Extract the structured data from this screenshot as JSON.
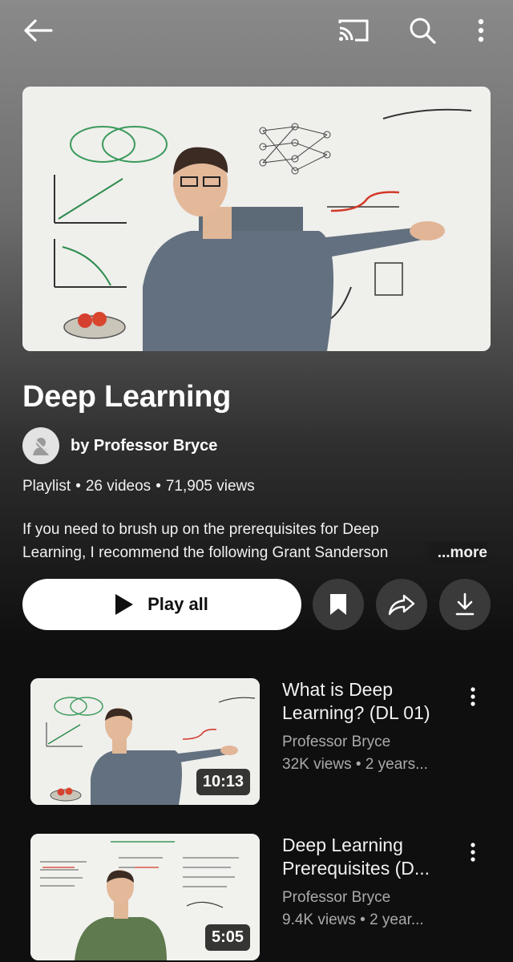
{
  "topbar": {
    "back_icon": "arrow-left-icon",
    "cast_icon": "cast-icon",
    "search_icon": "search-icon",
    "more_icon": "more-vertical-icon"
  },
  "playlist": {
    "title": "Deep Learning",
    "owner": "by Professor Bryce",
    "type": "Playlist",
    "video_count": "26 videos",
    "views": "71,905 views",
    "description_line1": "If you need to brush up on the prerequisites for Deep",
    "description_line2": "Learning, I recommend the following Grant Sanderson",
    "more_label": "...more"
  },
  "actions": {
    "play_all": "Play all",
    "save_icon": "bookmark-icon",
    "share_icon": "share-icon",
    "download_icon": "download-icon"
  },
  "videos": [
    {
      "title_line1": "What is Deep",
      "title_line2": "Learning? (DL 01)",
      "channel": "Professor Bryce",
      "stats": "32K views • 2 years...",
      "duration": "10:13"
    },
    {
      "title_line1": "Deep Learning",
      "title_line2": "Prerequisites (D...",
      "channel": "Professor Bryce",
      "stats": "9.4K views • 2 year...",
      "duration": "5:05"
    }
  ],
  "colors": {
    "background": "#0f0f0f",
    "button_dark": "#3a3a3a",
    "secondary_text": "#aaaaaa"
  }
}
